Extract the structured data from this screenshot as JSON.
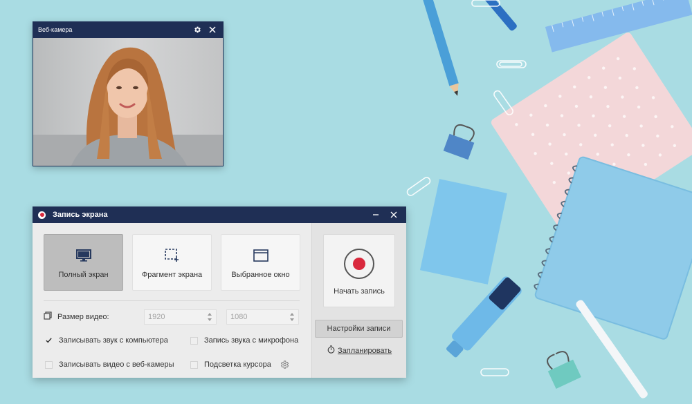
{
  "webcam": {
    "title": "Веб-камера",
    "icons": [
      "gear-icon",
      "close-icon"
    ]
  },
  "recorder": {
    "title": "Запись экрана",
    "modes": [
      {
        "label": "Полный экран",
        "icon": "monitor-icon",
        "active": true
      },
      {
        "label": "Фрагмент экрана",
        "icon": "region-select-icon",
        "active": false
      },
      {
        "label": "Выбранное окно",
        "icon": "window-icon",
        "active": false
      }
    ],
    "video_size": {
      "label": "Размер видео:",
      "width_value": "1920",
      "height_value": "1080"
    },
    "options": {
      "system_audio": {
        "label": "Записывать звук с компьютера",
        "checked": true
      },
      "mic_audio": {
        "label": "Запись звука с микрофона",
        "checked": false
      },
      "webcam_video": {
        "label": "Записывать видео с веб-камеры",
        "checked": false
      },
      "cursor_highlight": {
        "label": "Подсветка курсора",
        "checked": false
      }
    },
    "start_label": "Начать запись",
    "settings_label": "Настройки записи",
    "schedule_label": "Запланировать"
  },
  "colors": {
    "titlebar": "#1f2f55",
    "record_red": "#d9293d",
    "background": "#a9dce3"
  }
}
